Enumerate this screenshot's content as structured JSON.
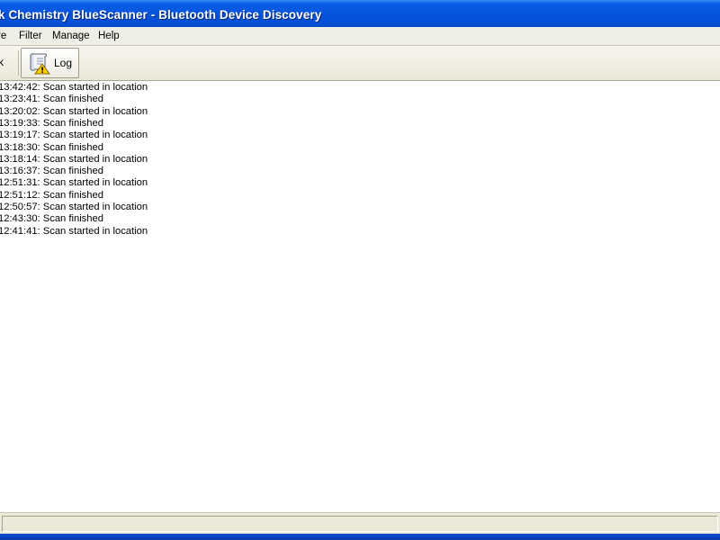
{
  "window": {
    "title": "k Chemistry BlueScanner - Bluetooth Device Discovery"
  },
  "menu": {
    "items": [
      {
        "label": "re"
      },
      {
        "label": "Filter"
      },
      {
        "label": "Manage"
      },
      {
        "label": "Help"
      }
    ]
  },
  "toolbar": {
    "left_label": "k",
    "log_label": "Log",
    "log_icon": "log-scroll-warning-icon"
  },
  "log": {
    "lines": [
      "13:42:42: Scan started in location",
      "13:23:41: Scan finished",
      "13:20:02: Scan started in location",
      "13:19:33: Scan finished",
      "13:19:17: Scan started in location",
      "13:18:30: Scan finished",
      "13:18:14: Scan started in location",
      "13:16:37: Scan finished",
      "12:51:31: Scan started in location",
      "12:51:12: Scan finished",
      "12:50:57: Scan started in location",
      "12:43:30: Scan finished",
      "12:41:41: Scan started in location"
    ]
  },
  "colors": {
    "titlebar": "#0654db",
    "window_bg": "#ece9d8",
    "log_bg": "#ffffff",
    "warning": "#ffcc00"
  }
}
